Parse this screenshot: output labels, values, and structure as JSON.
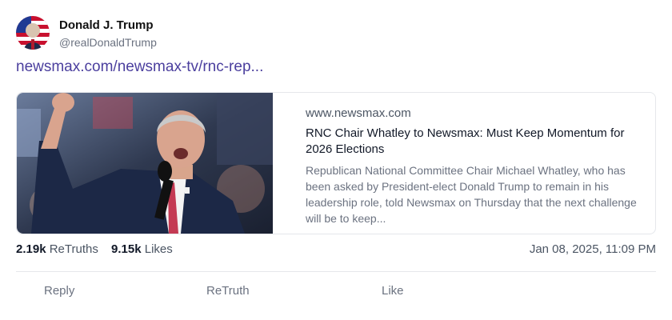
{
  "author": {
    "name": "Donald J. Trump",
    "handle": "@realDonaldTrump"
  },
  "post": {
    "link_text": "newsmax.com/newsmax-tv/rnc-rep..."
  },
  "link_card": {
    "domain": "www.newsmax.com",
    "title": "RNC Chair Whatley to Newsmax: Must Keep Momentum for 2026 Elections",
    "description": "Republican National Committee Chair Michael Whatley, who has been asked by President-elect Donald Trump to remain in his leadership role, told Newsmax on Thursday that the next challenge will be to keep..."
  },
  "stats": {
    "retruths_count": "2.19k",
    "retruths_label": "ReTruths",
    "likes_count": "9.15k",
    "likes_label": "Likes"
  },
  "timestamp": "Jan 08, 2025, 11:09 PM",
  "actions": {
    "reply": "Reply",
    "retruth": "ReTruth",
    "like": "Like"
  },
  "colors": {
    "link": "#4b3f9e",
    "muted_text": "#6b7280",
    "divider": "#e5e7eb"
  }
}
